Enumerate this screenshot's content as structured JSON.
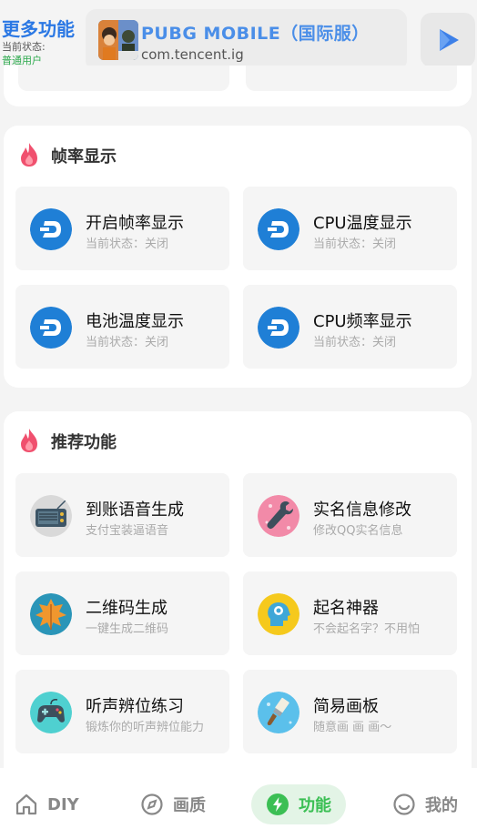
{
  "header": {
    "title": "更多功能",
    "status_label": "当前状态:",
    "status_value": "普通用户",
    "app": {
      "name": "PUBG MOBILE（国际服）",
      "package": "com.tencent.ig"
    }
  },
  "sections": {
    "fps": {
      "title": "帧率显示",
      "items": [
        {
          "title": "开启帧率显示",
          "subtitle": "当前状态：关闭",
          "icon": "dash-icon"
        },
        {
          "title": "CPU温度显示",
          "subtitle": "当前状态：关闭",
          "icon": "dash-icon"
        },
        {
          "title": "电池温度显示",
          "subtitle": "当前状态：关闭",
          "icon": "dash-icon"
        },
        {
          "title": "CPU频率显示",
          "subtitle": "当前状态：关闭",
          "icon": "dash-icon"
        }
      ]
    },
    "recommended": {
      "title": "推荐功能",
      "items": [
        {
          "title": "到账语音生成",
          "subtitle": "支付宝装逼语音",
          "icon": "radio-icon"
        },
        {
          "title": "实名信息修改",
          "subtitle": "修改QQ实名信息",
          "icon": "wrench-icon"
        },
        {
          "title": "二维码生成",
          "subtitle": "一键生成二维码",
          "icon": "leaf-icon"
        },
        {
          "title": "起名神器",
          "subtitle": "不会起名字？不用怕",
          "icon": "brain-icon"
        },
        {
          "title": "听声辨位练习",
          "subtitle": "锻炼你的听声辨位能力",
          "icon": "gamepad-icon"
        },
        {
          "title": "简易画板",
          "subtitle": "随意画 画 画～",
          "icon": "paintbrush-icon"
        }
      ]
    }
  },
  "nav": [
    {
      "label": "DIY",
      "icon": "home-icon",
      "active": false
    },
    {
      "label": "画质",
      "icon": "compass-icon",
      "active": false
    },
    {
      "label": "功能",
      "icon": "lightning-icon",
      "active": true
    },
    {
      "label": "我的",
      "icon": "smile-icon",
      "active": false
    }
  ],
  "colors": {
    "accent_blue": "#2b78e4",
    "status_green": "#2eaa4e",
    "nav_active": "#3bbf54",
    "dash_blue": "#1f7fd6",
    "flame_red": "#f0506e"
  }
}
